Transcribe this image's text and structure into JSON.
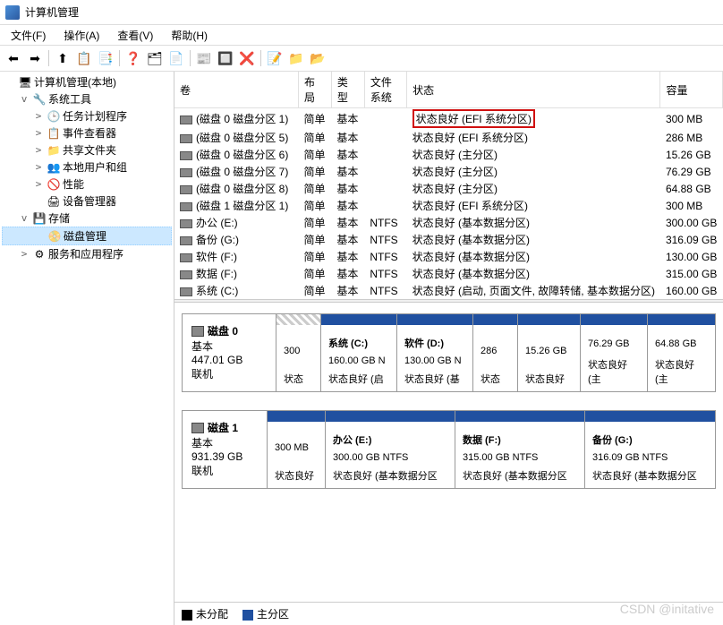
{
  "window": {
    "title": "计算机管理"
  },
  "menus": {
    "file": "文件(F)",
    "action": "操作(A)",
    "view": "查看(V)",
    "help": "帮助(H)"
  },
  "toolbar_icons": [
    "⬅",
    "➡",
    "⬆",
    "📋",
    "📑",
    "❓",
    "🗂",
    "📄",
    "📰",
    "🔲",
    "❌",
    "📝",
    "📁",
    "📂"
  ],
  "tree": {
    "root": "计算机管理(本地)",
    "system_tools": "系统工具",
    "task_scheduler": "任务计划程序",
    "event_viewer": "事件查看器",
    "shared_folders": "共享文件夹",
    "local_users": "本地用户和组",
    "performance": "性能",
    "device_manager": "设备管理器",
    "storage": "存储",
    "disk_management": "磁盘管理",
    "services_apps": "服务和应用程序"
  },
  "columns": {
    "volume": "卷",
    "layout": "布局",
    "type": "类型",
    "filesystem": "文件系统",
    "status": "状态",
    "capacity": "容量"
  },
  "rows": [
    {
      "vol": "(磁盘 0 磁盘分区 1)",
      "layout": "简单",
      "type": "基本",
      "fs": "",
      "status": "状态良好 (EFI 系统分区)",
      "cap": "300 MB",
      "hl": true
    },
    {
      "vol": "(磁盘 0 磁盘分区 5)",
      "layout": "简单",
      "type": "基本",
      "fs": "",
      "status": "状态良好 (EFI 系统分区)",
      "cap": "286 MB"
    },
    {
      "vol": "(磁盘 0 磁盘分区 6)",
      "layout": "简单",
      "type": "基本",
      "fs": "",
      "status": "状态良好 (主分区)",
      "cap": "15.26 GB"
    },
    {
      "vol": "(磁盘 0 磁盘分区 7)",
      "layout": "简单",
      "type": "基本",
      "fs": "",
      "status": "状态良好 (主分区)",
      "cap": "76.29 GB"
    },
    {
      "vol": "(磁盘 0 磁盘分区 8)",
      "layout": "简单",
      "type": "基本",
      "fs": "",
      "status": "状态良好 (主分区)",
      "cap": "64.88 GB"
    },
    {
      "vol": "(磁盘 1 磁盘分区 1)",
      "layout": "简单",
      "type": "基本",
      "fs": "",
      "status": "状态良好 (EFI 系统分区)",
      "cap": "300 MB"
    },
    {
      "vol": "办公 (E:)",
      "layout": "简单",
      "type": "基本",
      "fs": "NTFS",
      "status": "状态良好 (基本数据分区)",
      "cap": "300.00 GB"
    },
    {
      "vol": "备份 (G:)",
      "layout": "简单",
      "type": "基本",
      "fs": "NTFS",
      "status": "状态良好 (基本数据分区)",
      "cap": "316.09 GB"
    },
    {
      "vol": "软件 (F:)",
      "layout": "简单",
      "type": "基本",
      "fs": "NTFS",
      "status": "状态良好 (基本数据分区)",
      "cap": "130.00 GB"
    },
    {
      "vol": "数据 (F:)",
      "layout": "简单",
      "type": "基本",
      "fs": "NTFS",
      "status": "状态良好 (基本数据分区)",
      "cap": "315.00 GB"
    },
    {
      "vol": "系统 (C:)",
      "layout": "简单",
      "type": "基本",
      "fs": "NTFS",
      "status": "状态良好 (启动, 页面文件, 故障转储, 基本数据分区)",
      "cap": "160.00 GB"
    }
  ],
  "disks": [
    {
      "name": "磁盘 0",
      "basic": "基本",
      "size": "447.01 GB",
      "online": "联机",
      "parts": [
        {
          "title": "",
          "l1": "300",
          "l2": "状态",
          "w": 40,
          "hatched": true
        },
        {
          "title": "系统  (C:)",
          "l1": "160.00 GB N",
          "l2": "状态良好 (启",
          "w": 85
        },
        {
          "title": "软件  (D:)",
          "l1": "130.00 GB N",
          "l2": "状态良好 (基",
          "w": 85
        },
        {
          "title": "",
          "l1": "286",
          "l2": "状态",
          "w": 40
        },
        {
          "title": "",
          "l1": "15.26 GB",
          "l2": "状态良好",
          "w": 70
        },
        {
          "title": "",
          "l1": "76.29 GB",
          "l2": "状态良好 (主",
          "w": 75
        },
        {
          "title": "",
          "l1": "64.88 GB",
          "l2": "状态良好 (主",
          "w": 75
        }
      ]
    },
    {
      "name": "磁盘 1",
      "basic": "基本",
      "size": "931.39 GB",
      "online": "联机",
      "parts": [
        {
          "title": "",
          "l1": "300 MB",
          "l2": "状态良好",
          "w": 65
        },
        {
          "title": "办公  (E:)",
          "l1": "300.00 GB NTFS",
          "l2": "状态良好 (基本数据分区",
          "w": 145
        },
        {
          "title": "数据  (F:)",
          "l1": "315.00 GB NTFS",
          "l2": "状态良好 (基本数据分区",
          "w": 145
        },
        {
          "title": "备份  (G:)",
          "l1": "316.09 GB NTFS",
          "l2": "状态良好 (基本数据分区",
          "w": 145
        }
      ]
    }
  ],
  "legend": {
    "unallocated": "未分配",
    "primary": "主分区"
  },
  "watermark": "CSDN @initative"
}
